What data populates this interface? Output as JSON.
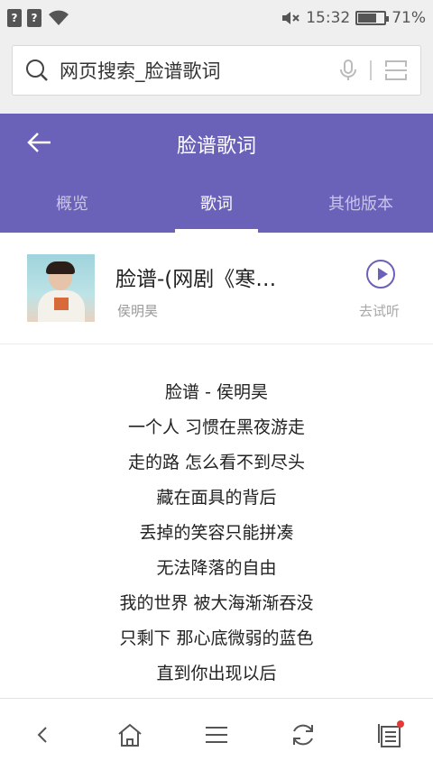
{
  "status": {
    "time": "15:32",
    "battery": "71%",
    "battery_level": 0.71,
    "sim1": "?",
    "sim2": "?"
  },
  "search": {
    "query": "网页搜索_脸谱歌词"
  },
  "header": {
    "title": "脸谱歌词",
    "tabs": [
      "概览",
      "歌词",
      "其他版本"
    ],
    "active_tab": 1
  },
  "song": {
    "title": "脸谱-(网剧《寒…",
    "artist": "侯明昊",
    "listen_label": "去试听"
  },
  "lyrics": [
    "脸谱 - 侯明昊",
    "一个人 习惯在黑夜游走",
    "走的路 怎么看不到尽头",
    "藏在面具的背后",
    "丢掉的笑容只能拼凑",
    "无法降落的自由",
    "我的世界 被大海渐渐吞没",
    "只剩下 那心底微弱的蓝色",
    "直到你出现以后"
  ],
  "colors": {
    "accent": "#6a61b8",
    "status_bg": "#efefef"
  },
  "icons": {
    "search": "search-icon",
    "mic": "mic-icon",
    "scan": "scan-icon",
    "back": "arrow-left-icon",
    "play": "play-circle-icon",
    "nav": [
      "chevron-left-icon",
      "home-icon",
      "menu-icon",
      "refresh-icon",
      "tabs-icon"
    ]
  }
}
